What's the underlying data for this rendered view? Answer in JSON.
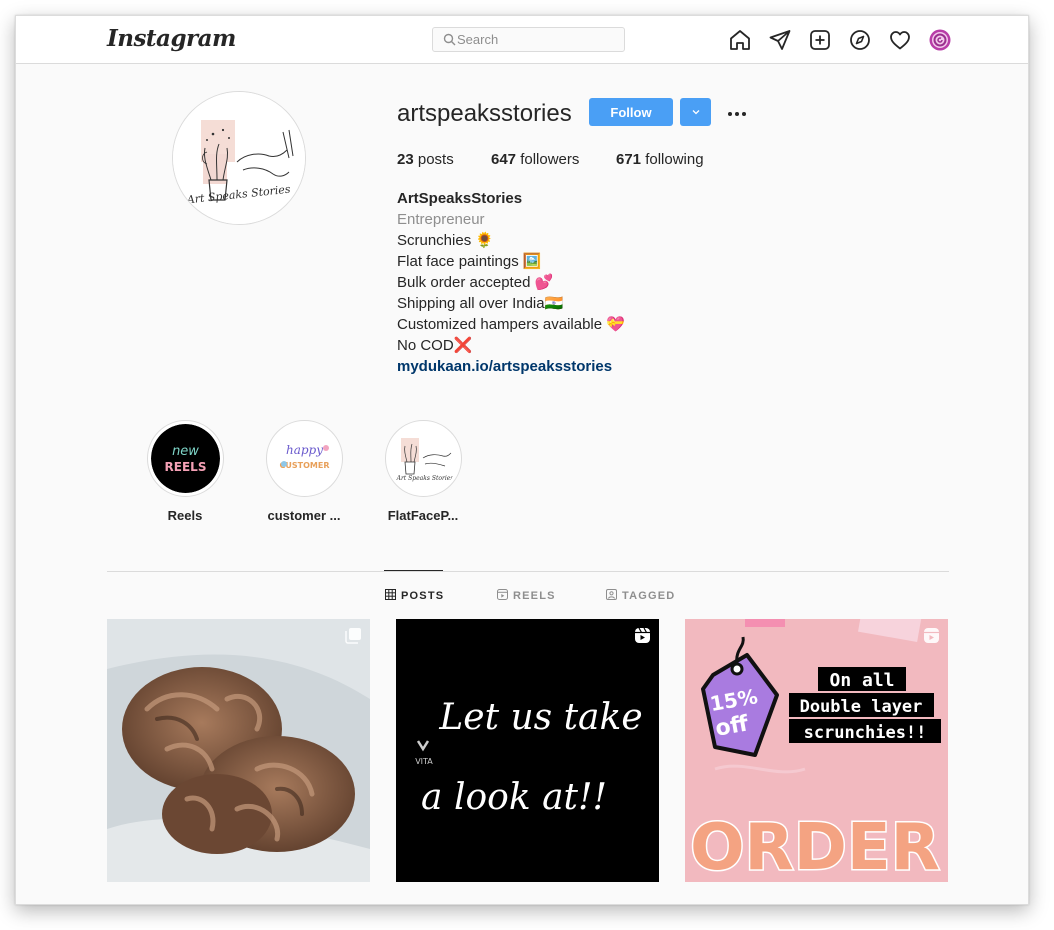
{
  "header": {
    "logo": "Instagram",
    "search_placeholder": "Search",
    "nav_icons": [
      "home-icon",
      "direct-icon",
      "new-post-icon",
      "explore-icon",
      "activity-icon",
      "profile-avatar"
    ]
  },
  "profile": {
    "username": "artspeaksstories",
    "follow_label": "Follow",
    "avatar_text": "Art Speaks Stories",
    "stats": {
      "posts_count": "23",
      "posts_label": "posts",
      "followers_count": "647",
      "followers_label": "followers",
      "following_count": "671",
      "following_label": "following"
    },
    "bio": {
      "name": "ArtSpeaksStories",
      "category": "Entrepreneur",
      "lines": [
        "Scrunchies 🌻",
        "Flat face paintings 🖼️",
        "Bulk order accepted 💕",
        "Shipping all over India🇮🇳",
        "Customized hampers available 💝",
        "No COD❌"
      ],
      "link": "mydukaan.io/artspeaksstories"
    }
  },
  "highlights": [
    {
      "label": "Reels",
      "art_line1": "new",
      "art_line2": "REELS"
    },
    {
      "label": "customer ...",
      "art_line1": "happy",
      "art_line2": "CUSTOMER"
    },
    {
      "label": "FlatFaceP...",
      "art_line1": "Art Speaks Stories"
    }
  ],
  "tabs": [
    {
      "label": "POSTS",
      "icon": "grid-icon",
      "active": true
    },
    {
      "label": "REELS",
      "icon": "reels-icon",
      "active": false
    },
    {
      "label": "TAGGED",
      "icon": "tagged-icon",
      "active": false
    }
  ],
  "posts": [
    {
      "type": "photo",
      "badge": "carousel-icon"
    },
    {
      "type": "reel",
      "badge": "reel-icon",
      "text_line1": "Let us take",
      "text_line2": "a look at!!",
      "brand": "VITA"
    },
    {
      "type": "reel",
      "badge": "reel-icon",
      "tag_percent": "15%",
      "tag_off": "off",
      "line1": "On all",
      "line2": "Double layer",
      "line3": "scrunchies!!",
      "bottom": "ORDER"
    }
  ],
  "colors": {
    "accent": "#4a9ff5",
    "link": "#00376b",
    "border": "#dbdbdb",
    "muted": "#8e8e8e"
  }
}
